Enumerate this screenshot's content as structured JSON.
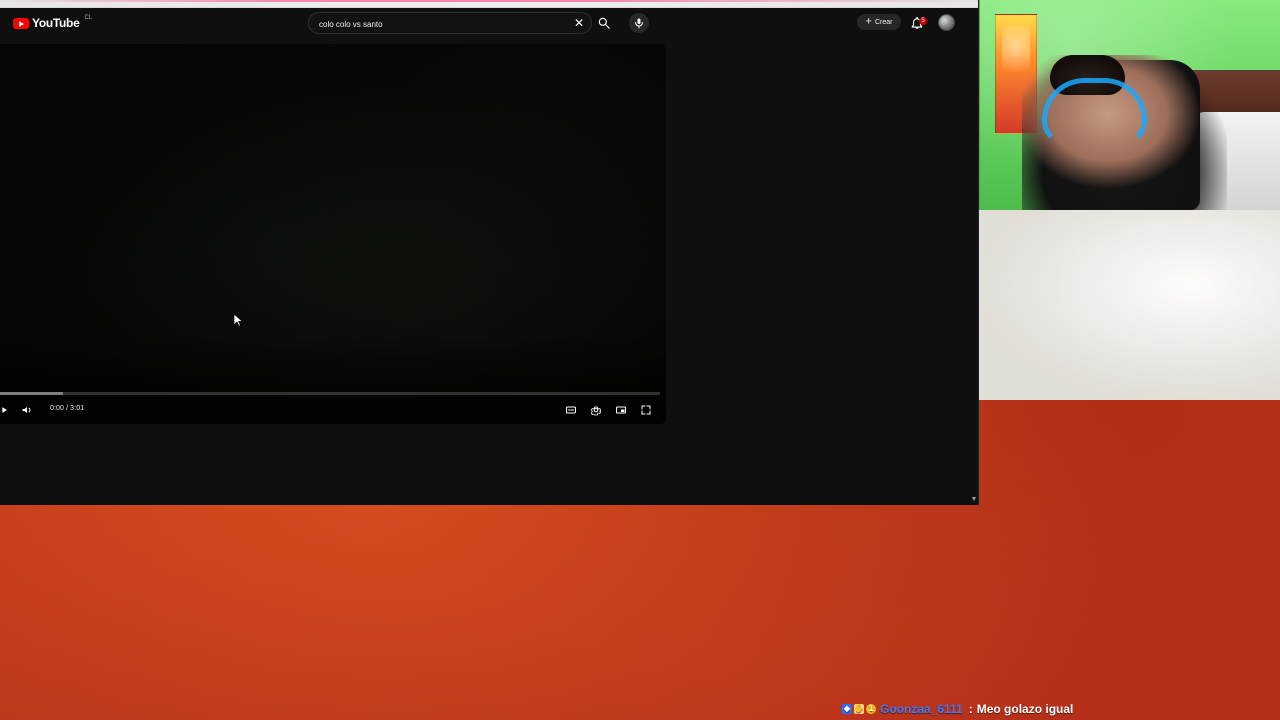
{
  "youtube": {
    "brand": "YouTube",
    "country_code": "CL",
    "search": {
      "query": "colo colo vs santo"
    },
    "actions": {
      "create_label": "Crear",
      "notifications_count": "5"
    }
  },
  "player": {
    "time_display": "0:00 / 3:01",
    "progress": {
      "played_fraction": 0.0,
      "buffered_fraction": 0.096
    },
    "icons": {
      "play": "play-icon",
      "volume": "volume-icon",
      "subtitles": "subtitles-icon",
      "settings": "gear-icon",
      "miniplayer": "miniplayer-icon",
      "fullscreen": "fullscreen-icon"
    }
  },
  "overlay": {
    "chat": {
      "username": "Goonzaa_6111",
      "message": "Meo golazo igual",
      "badges": [
        "shield-badge-icon",
        "hand-badge-icon",
        "gold-badge-icon"
      ]
    }
  },
  "colors": {
    "youtube_red": "#ff0000",
    "chat_username": "#3d7bff",
    "background_red": "#c8361a"
  }
}
